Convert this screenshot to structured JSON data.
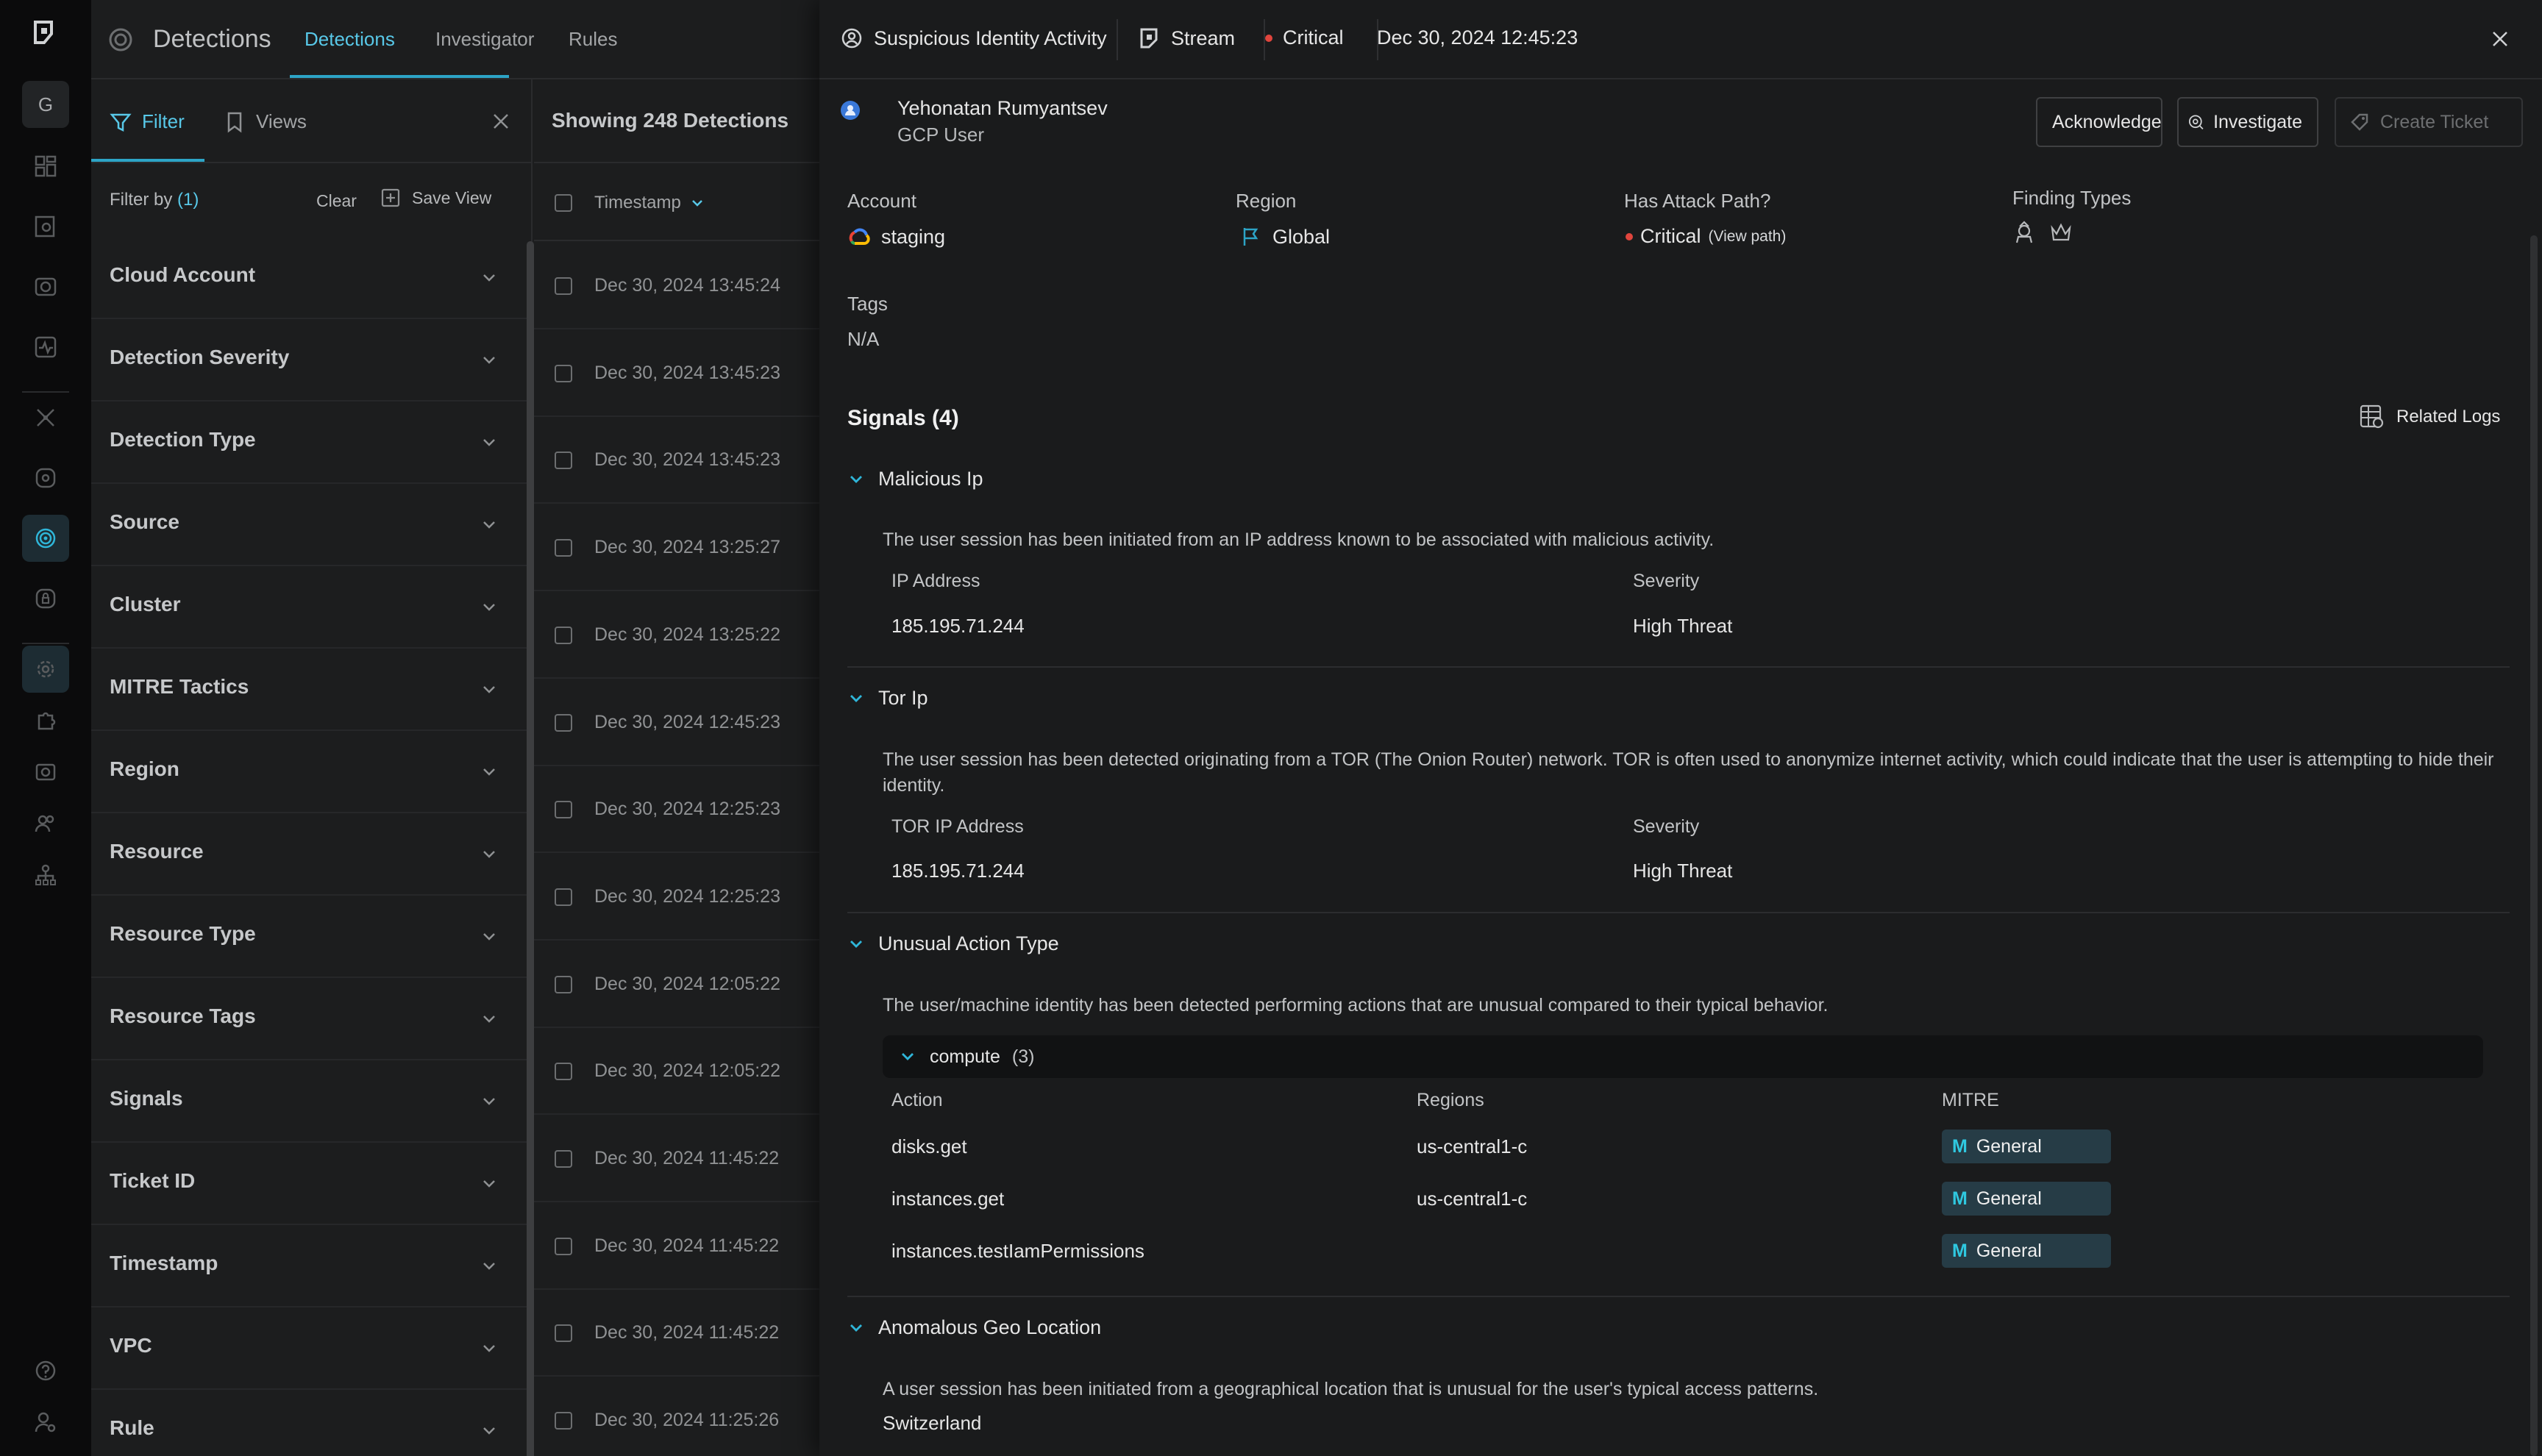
{
  "rail": {
    "avatar_letter": "G"
  },
  "topnav": {
    "title": "Detections",
    "tabs": [
      "Detections",
      "Investigator",
      "Rules"
    ]
  },
  "filters": {
    "tab_filter": "Filter",
    "tab_views": "Views",
    "filter_by_label": "Filter by",
    "filter_count": "(1)",
    "clear": "Clear",
    "save_view": "Save View",
    "groups": [
      "Cloud Account",
      "Detection Severity",
      "Detection Type",
      "Source",
      "Cluster",
      "MITRE Tactics",
      "Region",
      "Resource",
      "Resource Type",
      "Resource Tags",
      "Signals",
      "Ticket ID",
      "Timestamp",
      "VPC",
      "Rule"
    ]
  },
  "list": {
    "showing": "Showing 248 Detections",
    "column": "Timestamp",
    "timestamps": [
      "Dec 30, 2024 13:45:24",
      "Dec 30, 2024 13:45:23",
      "Dec 30, 2024 13:45:23",
      "Dec 30, 2024 13:25:27",
      "Dec 30, 2024 13:25:22",
      "Dec 30, 2024 12:45:23",
      "Dec 30, 2024 12:25:23",
      "Dec 30, 2024 12:25:23",
      "Dec 30, 2024 12:05:22",
      "Dec 30, 2024 12:05:22",
      "Dec 30, 2024 11:45:22",
      "Dec 30, 2024 11:45:22",
      "Dec 30, 2024 11:45:22",
      "Dec 30, 2024 11:25:26"
    ]
  },
  "detail": {
    "header": {
      "title": "Suspicious Identity Activity",
      "source": "Stream",
      "severity": "Critical",
      "timestamp": "Dec 30, 2024 12:45:23"
    },
    "user": {
      "name": "Yehonatan Rumyantsev",
      "type": "GCP User"
    },
    "actions": {
      "acknowledge": "Acknowledge",
      "investigate": "Investigate",
      "create_ticket": "Create Ticket"
    },
    "meta": {
      "account_label": "Account",
      "account_value": "staging",
      "region_label": "Region",
      "region_value": "Global",
      "attack_path_label": "Has Attack Path?",
      "attack_path_value": "Critical",
      "view_path": "(View path)",
      "finding_types_label": "Finding Types",
      "tags_label": "Tags",
      "tags_value": "N/A"
    },
    "signals_title": "Signals (4)",
    "related_logs": "Related Logs",
    "signals": {
      "malicious_ip": {
        "title": "Malicious Ip",
        "desc": "The user session has been initiated from an IP address known to be associated with malicious activity.",
        "col1": "IP Address",
        "col2": "Severity",
        "val1": "185.195.71.244",
        "val2": "High Threat"
      },
      "tor_ip": {
        "title": "Tor Ip",
        "desc": "The user session has been detected originating from a TOR (The Onion Router) network. TOR is often used to anonymize internet activity, which could indicate that the user is attempting to hide their identity.",
        "col1": "TOR IP Address",
        "col2": "Severity",
        "val1": "185.195.71.244",
        "val2": "High Threat"
      },
      "unusual_action": {
        "title": "Unusual Action Type",
        "desc": "The user/machine identity has been detected performing actions that are unusual compared to their typical behavior.",
        "group": "compute",
        "group_count": "(3)",
        "col_action": "Action",
        "col_regions": "Regions",
        "col_mitre": "MITRE",
        "rows": [
          {
            "action": "disks.get",
            "region": "us-central1-c",
            "mitre": "General"
          },
          {
            "action": "instances.get",
            "region": "us-central1-c",
            "mitre": "General"
          },
          {
            "action": "instances.testIamPermissions",
            "region": "",
            "mitre": "General"
          }
        ]
      },
      "geo": {
        "title": "Anomalous Geo Location",
        "desc": "A user session has been initiated from a geographical location that is unusual for the user's typical access patterns.",
        "location": "Switzerland"
      }
    }
  },
  "colors": {
    "accent": "#2da4c6",
    "critical": "#e0453d",
    "mitre_bg": "#263c46"
  }
}
